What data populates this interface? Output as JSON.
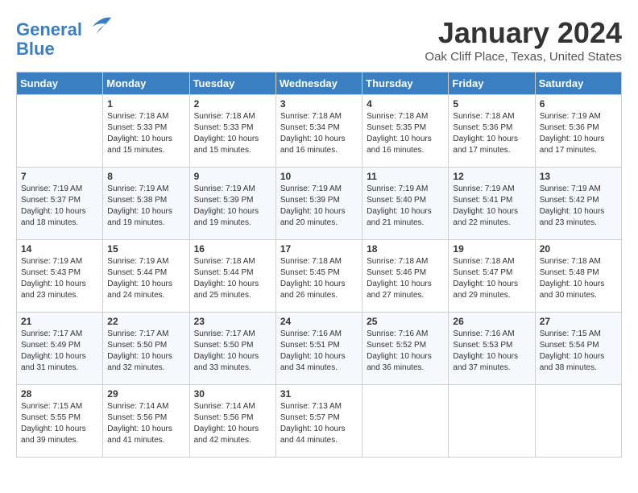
{
  "logo": {
    "line1": "General",
    "line2": "Blue"
  },
  "title": "January 2024",
  "subtitle": "Oak Cliff Place, Texas, United States",
  "weekdays": [
    "Sunday",
    "Monday",
    "Tuesday",
    "Wednesday",
    "Thursday",
    "Friday",
    "Saturday"
  ],
  "weeks": [
    [
      {
        "day": "",
        "sunrise": "",
        "sunset": "",
        "daylight": ""
      },
      {
        "day": "1",
        "sunrise": "Sunrise: 7:18 AM",
        "sunset": "Sunset: 5:33 PM",
        "daylight": "Daylight: 10 hours and 15 minutes."
      },
      {
        "day": "2",
        "sunrise": "Sunrise: 7:18 AM",
        "sunset": "Sunset: 5:33 PM",
        "daylight": "Daylight: 10 hours and 15 minutes."
      },
      {
        "day": "3",
        "sunrise": "Sunrise: 7:18 AM",
        "sunset": "Sunset: 5:34 PM",
        "daylight": "Daylight: 10 hours and 16 minutes."
      },
      {
        "day": "4",
        "sunrise": "Sunrise: 7:18 AM",
        "sunset": "Sunset: 5:35 PM",
        "daylight": "Daylight: 10 hours and 16 minutes."
      },
      {
        "day": "5",
        "sunrise": "Sunrise: 7:18 AM",
        "sunset": "Sunset: 5:36 PM",
        "daylight": "Daylight: 10 hours and 17 minutes."
      },
      {
        "day": "6",
        "sunrise": "Sunrise: 7:19 AM",
        "sunset": "Sunset: 5:36 PM",
        "daylight": "Daylight: 10 hours and 17 minutes."
      }
    ],
    [
      {
        "day": "7",
        "sunrise": "Sunrise: 7:19 AM",
        "sunset": "Sunset: 5:37 PM",
        "daylight": "Daylight: 10 hours and 18 minutes."
      },
      {
        "day": "8",
        "sunrise": "Sunrise: 7:19 AM",
        "sunset": "Sunset: 5:38 PM",
        "daylight": "Daylight: 10 hours and 19 minutes."
      },
      {
        "day": "9",
        "sunrise": "Sunrise: 7:19 AM",
        "sunset": "Sunset: 5:39 PM",
        "daylight": "Daylight: 10 hours and 19 minutes."
      },
      {
        "day": "10",
        "sunrise": "Sunrise: 7:19 AM",
        "sunset": "Sunset: 5:39 PM",
        "daylight": "Daylight: 10 hours and 20 minutes."
      },
      {
        "day": "11",
        "sunrise": "Sunrise: 7:19 AM",
        "sunset": "Sunset: 5:40 PM",
        "daylight": "Daylight: 10 hours and 21 minutes."
      },
      {
        "day": "12",
        "sunrise": "Sunrise: 7:19 AM",
        "sunset": "Sunset: 5:41 PM",
        "daylight": "Daylight: 10 hours and 22 minutes."
      },
      {
        "day": "13",
        "sunrise": "Sunrise: 7:19 AM",
        "sunset": "Sunset: 5:42 PM",
        "daylight": "Daylight: 10 hours and 23 minutes."
      }
    ],
    [
      {
        "day": "14",
        "sunrise": "Sunrise: 7:19 AM",
        "sunset": "Sunset: 5:43 PM",
        "daylight": "Daylight: 10 hours and 23 minutes."
      },
      {
        "day": "15",
        "sunrise": "Sunrise: 7:19 AM",
        "sunset": "Sunset: 5:44 PM",
        "daylight": "Daylight: 10 hours and 24 minutes."
      },
      {
        "day": "16",
        "sunrise": "Sunrise: 7:18 AM",
        "sunset": "Sunset: 5:44 PM",
        "daylight": "Daylight: 10 hours and 25 minutes."
      },
      {
        "day": "17",
        "sunrise": "Sunrise: 7:18 AM",
        "sunset": "Sunset: 5:45 PM",
        "daylight": "Daylight: 10 hours and 26 minutes."
      },
      {
        "day": "18",
        "sunrise": "Sunrise: 7:18 AM",
        "sunset": "Sunset: 5:46 PM",
        "daylight": "Daylight: 10 hours and 27 minutes."
      },
      {
        "day": "19",
        "sunrise": "Sunrise: 7:18 AM",
        "sunset": "Sunset: 5:47 PM",
        "daylight": "Daylight: 10 hours and 29 minutes."
      },
      {
        "day": "20",
        "sunrise": "Sunrise: 7:18 AM",
        "sunset": "Sunset: 5:48 PM",
        "daylight": "Daylight: 10 hours and 30 minutes."
      }
    ],
    [
      {
        "day": "21",
        "sunrise": "Sunrise: 7:17 AM",
        "sunset": "Sunset: 5:49 PM",
        "daylight": "Daylight: 10 hours and 31 minutes."
      },
      {
        "day": "22",
        "sunrise": "Sunrise: 7:17 AM",
        "sunset": "Sunset: 5:50 PM",
        "daylight": "Daylight: 10 hours and 32 minutes."
      },
      {
        "day": "23",
        "sunrise": "Sunrise: 7:17 AM",
        "sunset": "Sunset: 5:50 PM",
        "daylight": "Daylight: 10 hours and 33 minutes."
      },
      {
        "day": "24",
        "sunrise": "Sunrise: 7:16 AM",
        "sunset": "Sunset: 5:51 PM",
        "daylight": "Daylight: 10 hours and 34 minutes."
      },
      {
        "day": "25",
        "sunrise": "Sunrise: 7:16 AM",
        "sunset": "Sunset: 5:52 PM",
        "daylight": "Daylight: 10 hours and 36 minutes."
      },
      {
        "day": "26",
        "sunrise": "Sunrise: 7:16 AM",
        "sunset": "Sunset: 5:53 PM",
        "daylight": "Daylight: 10 hours and 37 minutes."
      },
      {
        "day": "27",
        "sunrise": "Sunrise: 7:15 AM",
        "sunset": "Sunset: 5:54 PM",
        "daylight": "Daylight: 10 hours and 38 minutes."
      }
    ],
    [
      {
        "day": "28",
        "sunrise": "Sunrise: 7:15 AM",
        "sunset": "Sunset: 5:55 PM",
        "daylight": "Daylight: 10 hours and 39 minutes."
      },
      {
        "day": "29",
        "sunrise": "Sunrise: 7:14 AM",
        "sunset": "Sunset: 5:56 PM",
        "daylight": "Daylight: 10 hours and 41 minutes."
      },
      {
        "day": "30",
        "sunrise": "Sunrise: 7:14 AM",
        "sunset": "Sunset: 5:56 PM",
        "daylight": "Daylight: 10 hours and 42 minutes."
      },
      {
        "day": "31",
        "sunrise": "Sunrise: 7:13 AM",
        "sunset": "Sunset: 5:57 PM",
        "daylight": "Daylight: 10 hours and 44 minutes."
      },
      {
        "day": "",
        "sunrise": "",
        "sunset": "",
        "daylight": ""
      },
      {
        "day": "",
        "sunrise": "",
        "sunset": "",
        "daylight": ""
      },
      {
        "day": "",
        "sunrise": "",
        "sunset": "",
        "daylight": ""
      }
    ]
  ]
}
